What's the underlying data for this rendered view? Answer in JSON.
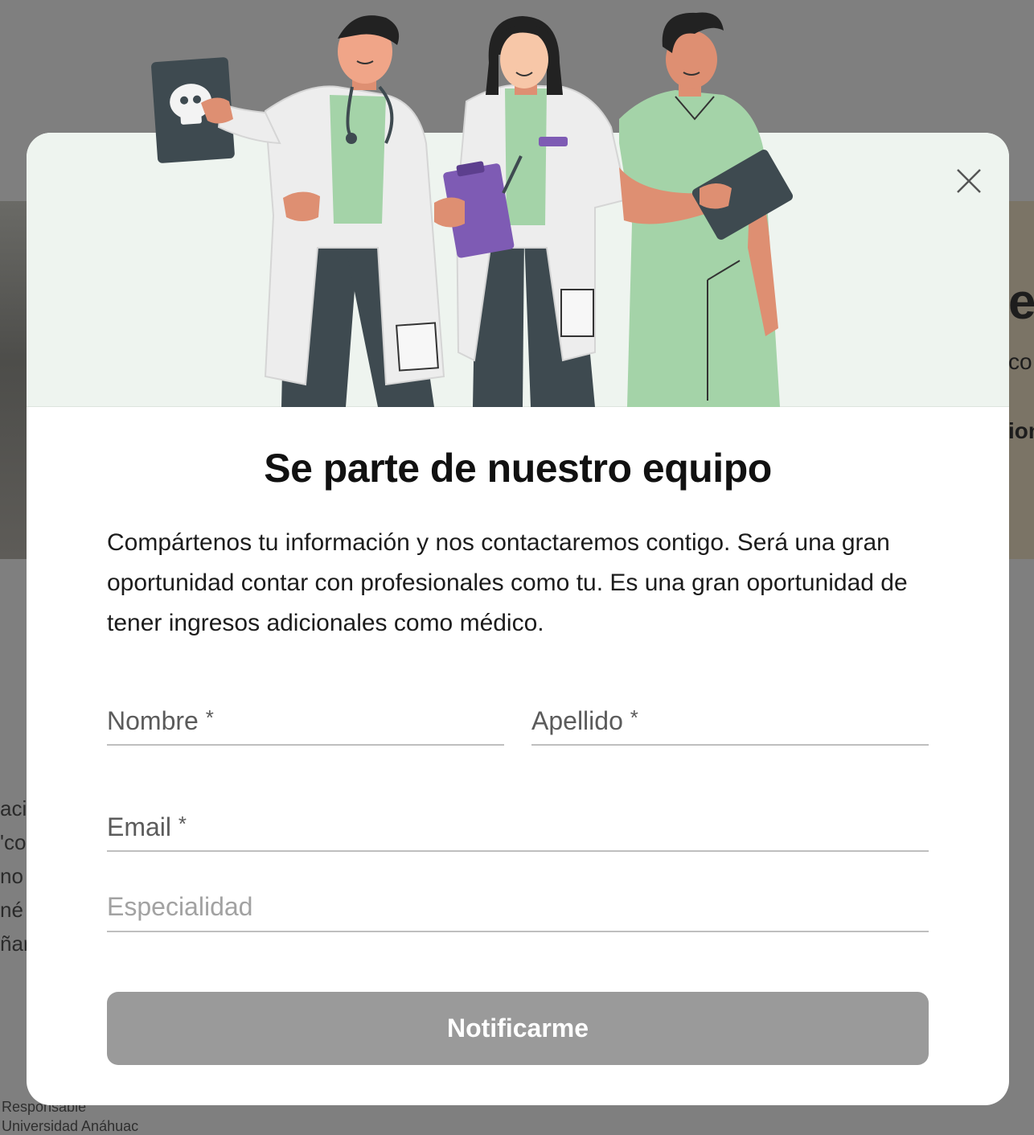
{
  "background": {
    "right_text": [
      "er",
      "co",
      "ion"
    ],
    "left_text": [
      "acil",
      "'co",
      "no",
      "né",
      "ñar"
    ],
    "footer_text": [
      "Responsable",
      "Universidad Anáhuac"
    ]
  },
  "modal": {
    "title": "Se parte de nuestro equipo",
    "description": "Compártenos tu información y nos contactaremos contigo. Será una gran oportunidad contar con profesionales como tu. Es una gran oportunidad de tener ingresos adicionales como médico.",
    "close_icon": "close-icon",
    "illustration": "doctors-team-illustration",
    "form": {
      "nombre_label": "Nombre",
      "apellido_label": "Apellido",
      "email_label": "Email",
      "especialidad_placeholder": "Especialidad",
      "required_mark": "*",
      "submit_label": "Notificarme"
    }
  },
  "colors": {
    "overlay": "#7f7f7f",
    "hero_bg": "#eef4ef",
    "button_disabled": "#9a9a9a",
    "scrub_green": "#a4d3a8",
    "clipboard_purple": "#7e5bb4"
  }
}
